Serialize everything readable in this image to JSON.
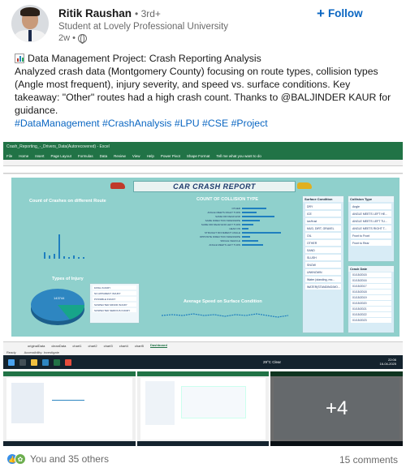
{
  "author": {
    "name": "Ritik Raushan",
    "degree": "• 3rd+",
    "headline": "Student at Lovely Professional University",
    "time": "2w •"
  },
  "follow_label": "Follow",
  "post": {
    "title": "Data Management Project: Crash Reporting Analysis",
    "body": "Analyzed crash data (Montgomery County) focusing on route types, collision types (Angle most frequent), injury severity, and speed vs. surface conditions. Key takeaway: \"Other\" routes had a high crash count. Thanks to @BALJINDER KAUR for guidance.",
    "hashtags": "#DataManagement #CrashAnalysis #LPU #CSE #Project"
  },
  "screenshot": {
    "window_title": "Crash_Reporting_-_Drivers_Data(Autorecovered) - Excel",
    "tabs": [
      "File",
      "Home",
      "Insert",
      "Page Layout",
      "Formulas",
      "Data",
      "Review",
      "View",
      "Help",
      "Power Pivot",
      "Shape Format"
    ],
    "tell_me": "Tell me what you want to do",
    "dashboard_title": "CAR CRASH REPORT",
    "panels": {
      "route_chart": "Count of Crashes on different Route",
      "collision_chart": "COUNT OF COLLISION TYPE",
      "injury_chart": "Types of Injury",
      "speed_chart": "Average Speed on Surface Condition"
    },
    "collision_labels": [
      "OTHER",
      "ANGLE MEETS RIGHT TURN",
      "SAME DIR REAR END",
      "SAME DIRECTION SIDESWIPE",
      "SAME DIR REAR END LEFT TURN",
      "HEAD ON",
      "STRAIGHT MOVEMENT ANGLE",
      "OPPOSITE DIRECTION SIDESWIPE",
      "SINGLE VEHICLE",
      "ANGLE MEETS LEFT TURN"
    ],
    "surface_header": "Surface Condition",
    "surface_items": [
      "DRY",
      "ICE",
      "ice/frost",
      "MUD, DIRT, GRAVEL",
      "OIL",
      "OTHER",
      "SAND",
      "SLUSH",
      "SNOW",
      "UNKNOWN",
      "Water (standing, mo...",
      "WATER(STANDING/MO..."
    ],
    "collision_header": "Collision Type",
    "collision_items": [
      "Angle",
      "ANGLE MEETS LEFT HE...",
      "ANGLE MEETS LEFT TU...",
      "ANGLE MEETS RIGHT T...",
      "Front to Front",
      "Front to Rear"
    ],
    "crash_date_header": "Crash Date",
    "crash_dates": [
      "01/15/2015",
      "01/15/2016",
      "01/15/2017",
      "01/15/2018",
      "01/15/2019",
      "01/15/2020",
      "01/15/2021",
      "01/15/2022",
      "01/15/2023"
    ],
    "injury_legend": [
      "FATAL INJURY",
      "NO APPARENT INJURY",
      "POSSIBLE INJURY",
      "SUSPECTED MINOR INJURY",
      "SUSPECTED SERIOUS INJURY"
    ],
    "injury_value": "143744",
    "sheet_tabs": [
      "originalData",
      "cleanData",
      "chart1",
      "chart2",
      "chart3",
      "chart4",
      "chart5",
      "Dashboard"
    ],
    "status": [
      "Ready",
      "Accessibility: Investigate"
    ],
    "weather": "29°C Clear",
    "clock_time": "22:06",
    "clock_date": "16-04-2025"
  },
  "more_count": "+4",
  "reactions_text": "You and 35 others",
  "comments_text": "15 comments"
}
